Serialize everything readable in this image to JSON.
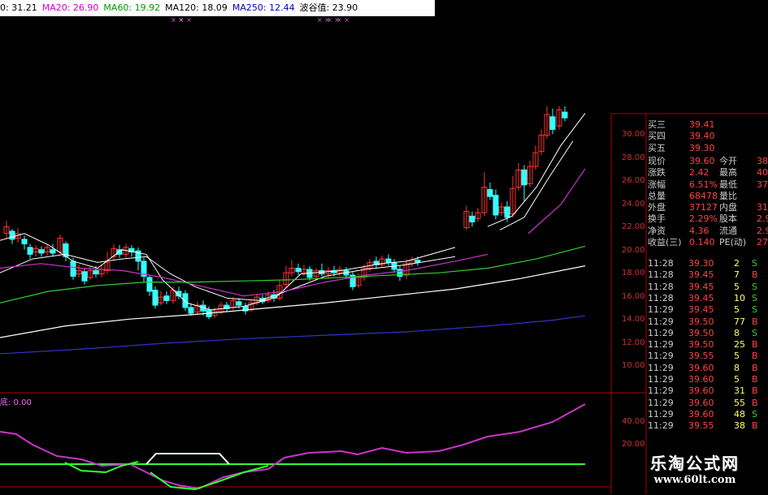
{
  "ma_bar": [
    {
      "text": "0: 31.21",
      "color": "#000000"
    },
    {
      "text": "MA20: 26.90",
      "color": "#cc00cc"
    },
    {
      "text": "MA60: 19.92",
      "color": "#009900"
    },
    {
      "text": "MA120: 18.09",
      "color": "#000000"
    },
    {
      "text": "MA250: 12.44",
      "color": "#0000cc"
    },
    {
      "text": "波谷值: 23.90",
      "color": "#000000"
    }
  ],
  "price_axis": [
    "30.00",
    "28.00",
    "26.00",
    "24.00",
    "22.00",
    "20.00",
    "18.00",
    "16.00",
    "14.00",
    "12.00",
    "10.00"
  ],
  "osc_axis": [
    "40.00",
    "20.00"
  ],
  "osc_label": "底: 0.00",
  "quote": [
    {
      "label": "买三",
      "value": "39.41"
    },
    {
      "label": "买四",
      "value": "39.40"
    },
    {
      "label": "买五",
      "value": "39.30"
    },
    {
      "label": "现价",
      "value": "39.60",
      "label2": "今开",
      "value2": "38"
    },
    {
      "label": "涨跌",
      "value": "2.42",
      "label2": "最高",
      "value2": "40"
    },
    {
      "label": "涨幅",
      "value": "6.51%",
      "label2": "最低",
      "value2": "37"
    },
    {
      "label": "总量",
      "value": "68478",
      "label2": "量比",
      "value2": ""
    },
    {
      "label": "外盘",
      "value": "37127",
      "label2": "内盘",
      "value2": "31"
    },
    {
      "label": "换手",
      "value": "2.29%",
      "label2": "股本",
      "value2": "2.9"
    },
    {
      "label": "净资",
      "value": "4.36",
      "label2": "流通",
      "value2": "2.9"
    },
    {
      "label": "收益(三)",
      "value": "0.140",
      "label2": "PE(动)",
      "value2": "27"
    }
  ],
  "ticks": [
    {
      "time": "11:28",
      "price": "39.30",
      "vol": "2",
      "side": "S"
    },
    {
      "time": "11:28",
      "price": "39.45",
      "vol": "7",
      "side": "B"
    },
    {
      "time": "11:28",
      "price": "39.45",
      "vol": "5",
      "side": "S"
    },
    {
      "time": "11:28",
      "price": "39.45",
      "vol": "10",
      "side": "S"
    },
    {
      "time": "11:29",
      "price": "39.45",
      "vol": "5",
      "side": "S"
    },
    {
      "time": "11:29",
      "price": "39.50",
      "vol": "77",
      "side": "B"
    },
    {
      "time": "11:29",
      "price": "39.50",
      "vol": "8",
      "side": "S"
    },
    {
      "time": "11:29",
      "price": "39.50",
      "vol": "25",
      "side": "B"
    },
    {
      "time": "11:29",
      "price": "39.55",
      "vol": "5",
      "side": "B"
    },
    {
      "time": "11:29",
      "price": "39.60",
      "vol": "8",
      "side": "B"
    },
    {
      "time": "11:29",
      "price": "39.60",
      "vol": "5",
      "side": "B"
    },
    {
      "time": "11:29",
      "price": "39.60",
      "vol": "31",
      "side": "B"
    },
    {
      "time": "11:29",
      "price": "39.60",
      "vol": "55",
      "side": "B"
    },
    {
      "time": "11:29",
      "price": "39.60",
      "vol": "48",
      "side": "S"
    },
    {
      "time": "11:29",
      "price": "39.55",
      "vol": "38",
      "side": "B"
    }
  ],
  "watermark": {
    "title": "乐淘公式网",
    "url": "www.60lt.com"
  },
  "colors": {
    "up": "#ff3333",
    "down": "#33ffff",
    "ma5": "#ffffff",
    "ma20": "#cc33cc",
    "ma60": "#33cc33",
    "ma120": "#ffffff",
    "ma250": "#3333cc",
    "osc": "#cc33cc",
    "base": "#33ff33"
  }
}
